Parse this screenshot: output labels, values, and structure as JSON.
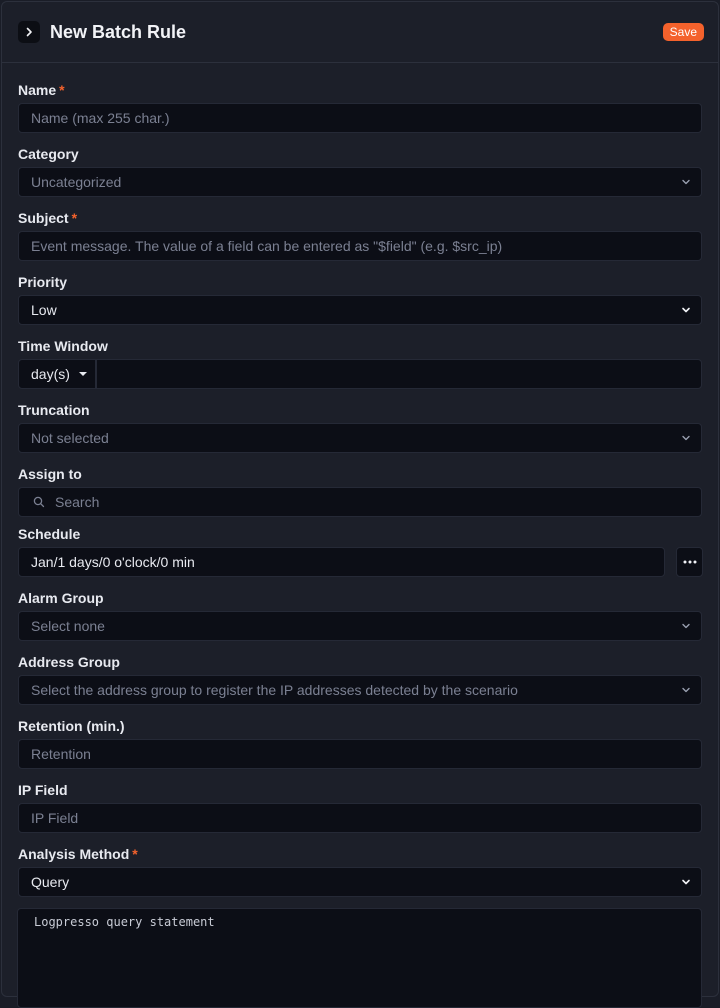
{
  "header": {
    "title": "New Batch Rule",
    "save_label": "Save"
  },
  "fields": {
    "name": {
      "label": "Name",
      "required": true,
      "placeholder": "Name (max 255 char.)"
    },
    "category": {
      "label": "Category",
      "placeholder": "Uncategorized"
    },
    "subject": {
      "label": "Subject",
      "required": true,
      "placeholder": "Event message. The value of a field can be entered as \"$field\" (e.g. $src_ip)"
    },
    "priority": {
      "label": "Priority",
      "value": "Low"
    },
    "time_window": {
      "label": "Time Window",
      "unit": "day(s)",
      "value": ""
    },
    "truncation": {
      "label": "Truncation",
      "placeholder": "Not selected"
    },
    "assign_to": {
      "label": "Assign to",
      "placeholder": "Search"
    },
    "schedule": {
      "label": "Schedule",
      "value": "Jan/1 days/0 o'clock/0 min"
    },
    "alarm_group": {
      "label": "Alarm Group",
      "placeholder": "Select none"
    },
    "address_group": {
      "label": "Address Group",
      "placeholder": "Select the address group to register the IP addresses detected by the scenario"
    },
    "retention": {
      "label": "Retention (min.)",
      "placeholder": "Retention"
    },
    "ip_field": {
      "label": "IP Field",
      "placeholder": "IP Field"
    },
    "analysis_method": {
      "label": "Analysis Method",
      "required": true,
      "value": "Query"
    },
    "query": {
      "placeholder": "Logpresso query statement"
    }
  },
  "icons": {
    "collapse": "chevron-right-icon",
    "dropdown": "chevron-down-icon",
    "search": "search-icon",
    "more": "more-horizontal-icon"
  },
  "colors": {
    "accent": "#f4622c",
    "background": "#1c1f29",
    "input": "#0c0e16"
  }
}
